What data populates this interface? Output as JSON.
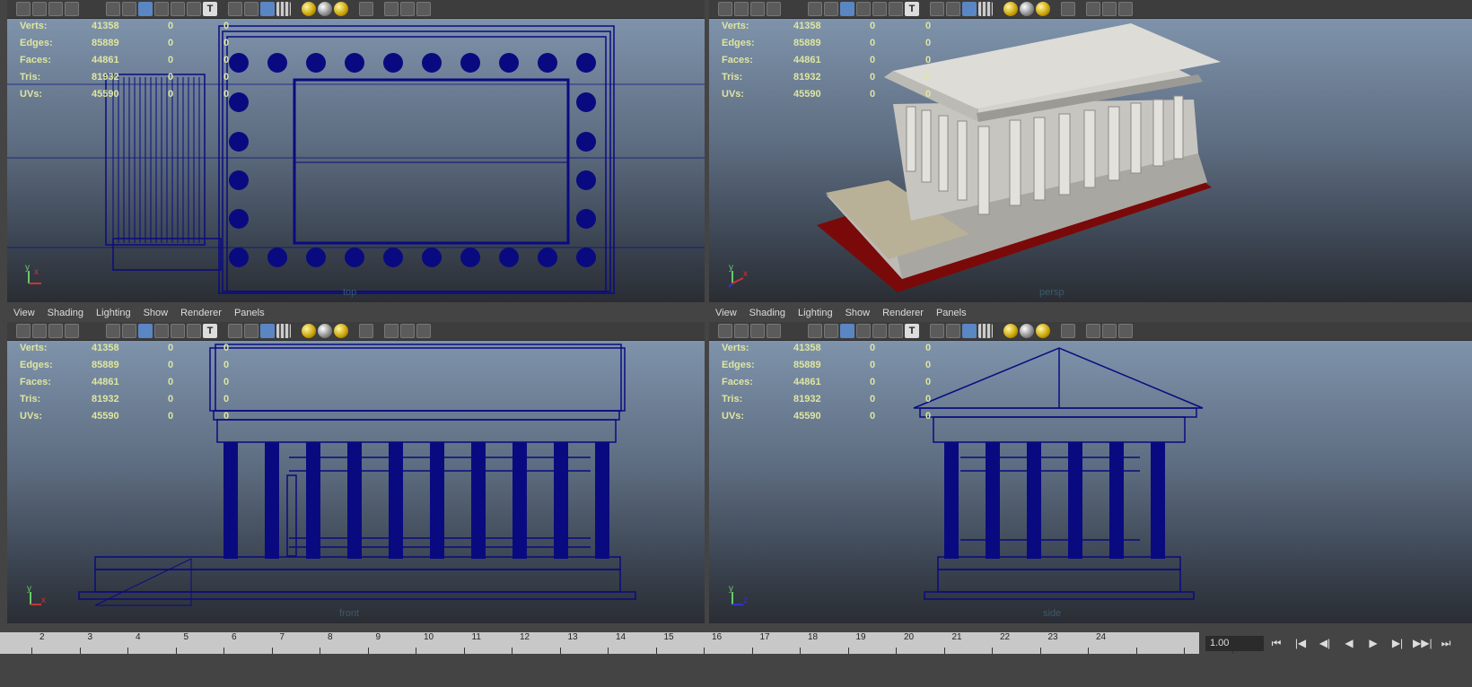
{
  "menu": [
    "View",
    "Shading",
    "Lighting",
    "Show",
    "Renderer",
    "Panels"
  ],
  "hud": {
    "labels": [
      "Verts:",
      "Edges:",
      "Faces:",
      "Tris:",
      "UVs:"
    ],
    "values": [
      "41358",
      "85889",
      "44861",
      "81932",
      "45590"
    ],
    "selected": [
      "0",
      "0",
      "0",
      "0",
      "0"
    ],
    "components": [
      "0",
      "0",
      "0",
      "0",
      "0"
    ]
  },
  "cameras": {
    "top": "top",
    "persp": "persp",
    "front": "front",
    "side": "side"
  },
  "axes": {
    "y": "y",
    "x": "x",
    "z": "z"
  },
  "toolbar_icons": [
    "camera-icon",
    "camera-attr-icon",
    "bookmark-icon",
    "image-plane-icon",
    "grid-toggle-icon",
    "wireframe-icon",
    "smooth-shade-icon",
    "textured-icon",
    "lights-icon",
    "shadows-icon",
    "xray-icon",
    "isolate-icon",
    "hud-icon",
    "select-cam-icon",
    "resolution-gate-icon",
    "film-gate-icon",
    "safe-title-icon"
  ],
  "timeline": {
    "ticks": [
      "2",
      "3",
      "4",
      "5",
      "6",
      "7",
      "8",
      "9",
      "10",
      "11",
      "12",
      "13",
      "14",
      "15",
      "16",
      "17",
      "18",
      "19",
      "20",
      "21",
      "22",
      "23",
      "24"
    ],
    "current_frame": "1.00",
    "playback": [
      "⏮",
      "|◀",
      "◀|",
      "◀",
      "▶",
      "▶|",
      "▶▶|",
      "⏭"
    ]
  },
  "colors": {
    "wireframe": "#0a0a80",
    "marble": "#c8c6c2",
    "red_base": "#7a0a0a"
  }
}
